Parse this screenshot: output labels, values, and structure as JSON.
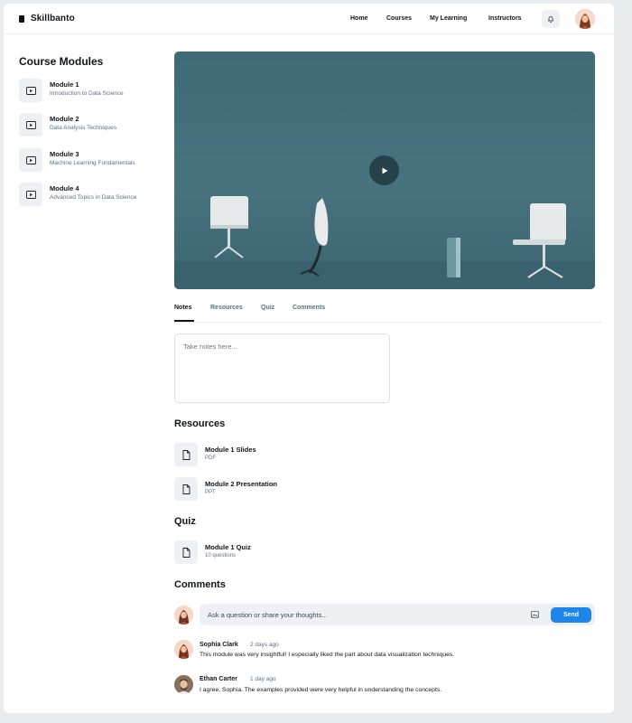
{
  "header": {
    "brand": "Skillbanto",
    "nav": [
      "Home",
      "Courses",
      "My Learning",
      "Instructors"
    ]
  },
  "sidebar": {
    "title": "Course Modules",
    "modules": [
      {
        "title": "Module 1",
        "subtitle": "Introduction to Data Science"
      },
      {
        "title": "Module 2",
        "subtitle": "Data Analysis Techniques"
      },
      {
        "title": "Module 3",
        "subtitle": "Machine Learning Fundamentals"
      },
      {
        "title": "Module 4",
        "subtitle": "Advanced Topics in Data Science"
      }
    ]
  },
  "tabs": [
    "Notes",
    "Resources",
    "Quiz",
    "Comments"
  ],
  "notes": {
    "placeholder": "Take notes here..."
  },
  "resources": {
    "title": "Resources",
    "items": [
      {
        "title": "Module 1 Slides",
        "type": "PDF"
      },
      {
        "title": "Module 2 Presentation",
        "type": "PPT"
      }
    ]
  },
  "quiz": {
    "title": "Quiz",
    "items": [
      {
        "title": "Module 1 Quiz",
        "meta": "10 questions"
      }
    ]
  },
  "comments": {
    "title": "Comments",
    "input_placeholder": "Ask a question or share your thoughts...",
    "send_label": "Send",
    "items": [
      {
        "author": "Sophia Clark",
        "time": "2 days ago",
        "text": "This module was very insightful! I especially liked the part about data visualization techniques."
      },
      {
        "author": "Ethan Carter",
        "time": "1 day ago",
        "text": "I agree, Sophia. The examples provided were very helpful in understanding the concepts."
      }
    ]
  },
  "colors": {
    "accent": "#1d86ea",
    "video_bg": "#44707c",
    "muted_text": "#5a6f8a"
  }
}
